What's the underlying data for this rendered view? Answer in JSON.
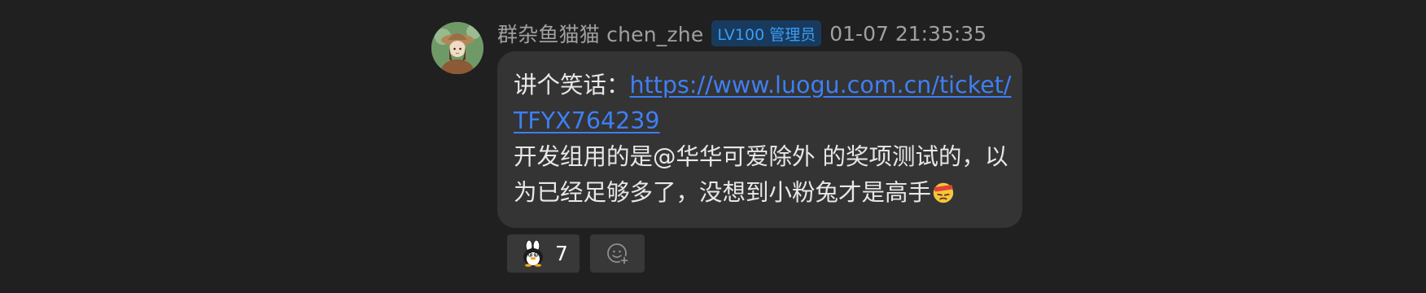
{
  "message": {
    "author": {
      "display_name": "群杂鱼猫猫 chen_zhe",
      "badge": "LV100 管理员",
      "avatar_icon": "avatar-image"
    },
    "timestamp": "01-07 21:35:35",
    "body": {
      "line1_prefix": "讲个笑话：",
      "link_part1": "https://www.luogu.com.cn/ticket/",
      "link_part2": "TFYX764239",
      "line3": "开发组用的是@华华可爱除外 的奖项测试的，以",
      "line4": "为已经足够多了，没想到小粉兔才是高手",
      "emoji_icon": "bandage-head-emoji"
    },
    "reactions": [
      {
        "icon": "rabbit-penguin-icon",
        "count": "7"
      },
      {
        "icon": "add-reaction-icon",
        "count": ""
      }
    ]
  },
  "colors": {
    "background": "#202020",
    "bubble": "#343434",
    "link": "#3f7ff5",
    "badge_bg": "#173a5e",
    "badge_text": "#3d9df2",
    "meta_text": "#a0a0a0"
  }
}
